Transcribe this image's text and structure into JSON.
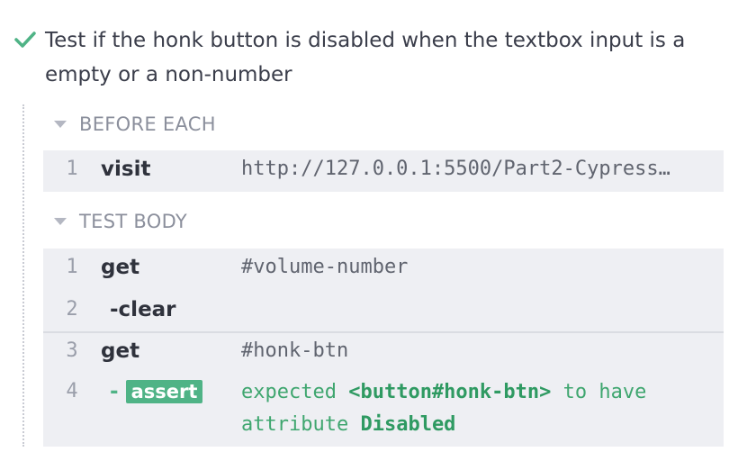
{
  "test": {
    "title": "Test if the honk button is disabled when the textbox input is a empty or a non-number",
    "status_icon": "check-icon",
    "status_color": "#4fb386"
  },
  "before_each": {
    "label": "BEFORE EACH",
    "commands": [
      {
        "num": "1",
        "name": "visit",
        "message": "http://127.0.0.1:5500/Part2-Cypress…"
      }
    ]
  },
  "test_body": {
    "label": "TEST BODY",
    "commands": [
      {
        "num": "1",
        "name": "get",
        "message": "#volume-number"
      },
      {
        "num": "2",
        "name": "-clear",
        "message": ""
      },
      {
        "num": "3",
        "name": "get",
        "message": "#honk-btn"
      },
      {
        "num": "4",
        "prefix": "-",
        "name": "assert",
        "message_parts": [
          "expected",
          "<button#honk-btn>",
          "to have",
          "attribute",
          "Disabled"
        ]
      }
    ]
  }
}
